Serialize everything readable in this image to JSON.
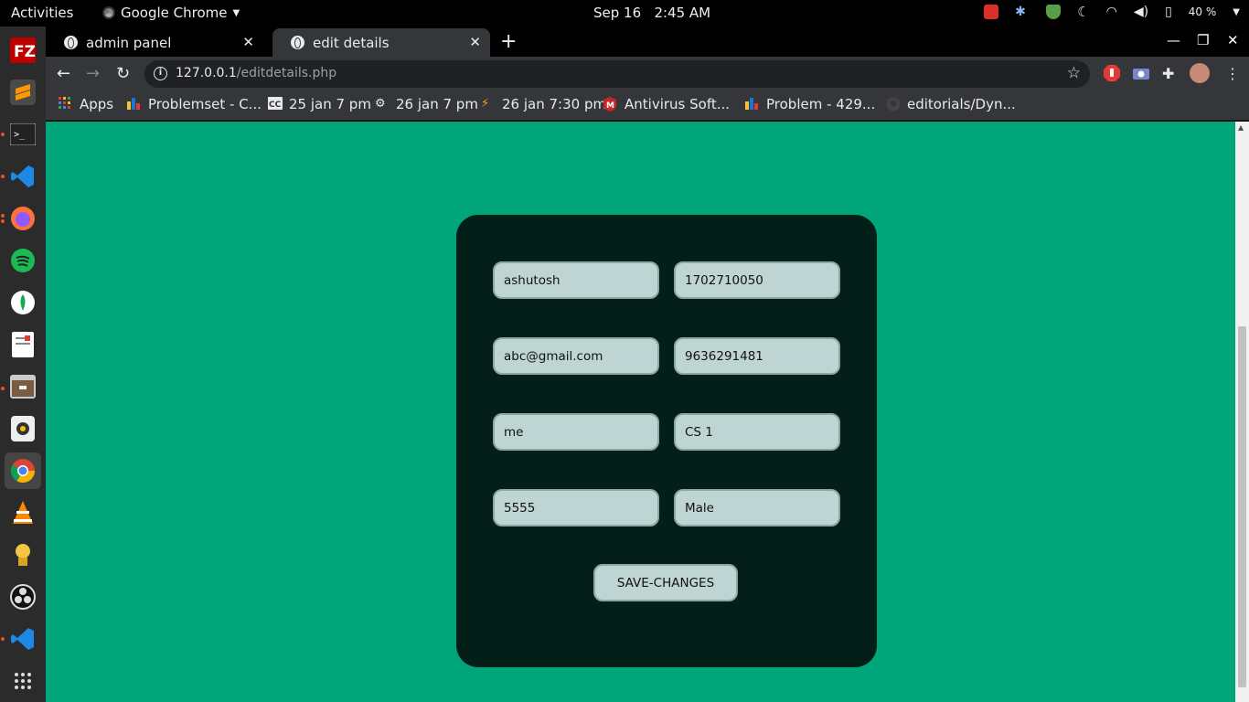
{
  "system_bar": {
    "activities": "Activities",
    "app_name": "Google Chrome",
    "date": "Sep 16",
    "time": "2:45 AM",
    "battery": "40 %"
  },
  "browser": {
    "tabs": [
      {
        "title": "admin panel",
        "active": false
      },
      {
        "title": "edit details",
        "active": true
      }
    ],
    "url_host": "127.0.0.1",
    "url_path": "/editdetails.php",
    "bookmarks": [
      "Apps",
      "Problemset - C...",
      "25 jan 7 pm",
      "26 jan 7 pm",
      "26 jan 7:30 pm",
      "Antivirus Soft...",
      "Problem - 429...",
      "editorials/Dyn..."
    ]
  },
  "form": {
    "fields": [
      {
        "name": "name",
        "value": "ashutosh"
      },
      {
        "name": "roll",
        "value": "1702710050"
      },
      {
        "name": "email",
        "value": "abc@gmail.com"
      },
      {
        "name": "phone",
        "value": "9636291481"
      },
      {
        "name": "username",
        "value": "me"
      },
      {
        "name": "branch",
        "value": "CS 1"
      },
      {
        "name": "password",
        "value": "5555"
      },
      {
        "name": "gender",
        "value": "Male"
      }
    ],
    "save_label": "SAVE-CHANGES"
  },
  "colors": {
    "page_bg": "#00a579",
    "card_bg": "#031f18",
    "field_bg": "#bfd5d3"
  }
}
